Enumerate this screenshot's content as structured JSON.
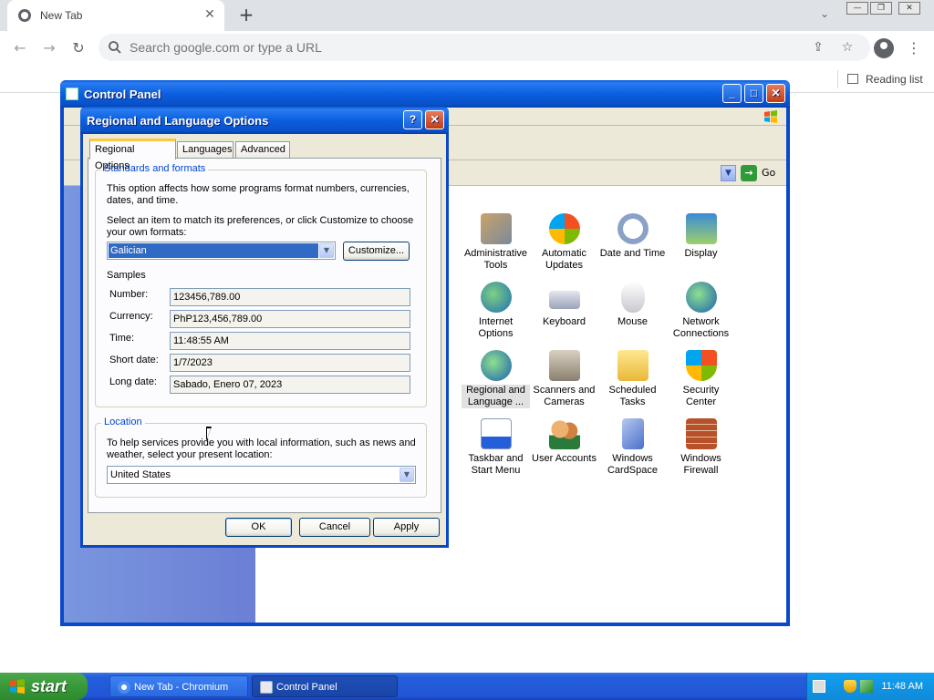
{
  "browser": {
    "tab_title": "New Tab",
    "omnibox_placeholder": "Search google.com or type a URL",
    "reading_list": "Reading list"
  },
  "control_panel": {
    "title": "Control Panel",
    "go_label": "Go",
    "items": [
      {
        "label": "Administrative Tools",
        "icon": "admin-tools-icon"
      },
      {
        "label": "Automatic Updates",
        "icon": "auto-updates-icon"
      },
      {
        "label": "Date and Time",
        "icon": "date-time-icon"
      },
      {
        "label": "Display",
        "icon": "display-icon"
      },
      {
        "label": "Internet Options",
        "icon": "internet-options-icon"
      },
      {
        "label": "Keyboard",
        "icon": "keyboard-icon"
      },
      {
        "label": "Mouse",
        "icon": "mouse-icon"
      },
      {
        "label": "Network Connections",
        "icon": "network-icon"
      },
      {
        "label": "Regional and Language ...",
        "icon": "regional-icon"
      },
      {
        "label": "Scanners and Cameras",
        "icon": "scanner-icon"
      },
      {
        "label": "Scheduled Tasks",
        "icon": "scheduled-tasks-icon"
      },
      {
        "label": "Security Center",
        "icon": "security-icon"
      },
      {
        "label": "Taskbar and Start Menu",
        "icon": "taskbar-icon"
      },
      {
        "label": "User Accounts",
        "icon": "user-accounts-icon"
      },
      {
        "label": "Windows CardSpace",
        "icon": "cardspace-icon"
      },
      {
        "label": "Windows Firewall",
        "icon": "firewall-icon"
      }
    ]
  },
  "dialog": {
    "title": "Regional and Language Options",
    "help_label": "?",
    "close_label": "✕",
    "tabs": [
      "Regional Options",
      "Languages",
      "Advanced"
    ],
    "standards": {
      "legend": "Standards and formats",
      "desc1": "This option affects how some programs format numbers, currencies, dates, and time.",
      "desc2": "Select an item to match its preferences, or click Customize to choose your own formats:",
      "selected_format": "Galician",
      "customize_label": "Customize...",
      "samples_label": "Samples",
      "samples": [
        {
          "label": "Number:",
          "value": "123456,789.00"
        },
        {
          "label": "Currency:",
          "value": "PhP123,456,789.00"
        },
        {
          "label": "Time:",
          "value": "11:48:55 AM"
        },
        {
          "label": "Short date:",
          "value": "1/7/2023"
        },
        {
          "label": "Long date:",
          "value": "Sabado, Enero 07, 2023"
        }
      ]
    },
    "location": {
      "legend": "Location",
      "desc": "To help services provide you with local information, such as news and weather, select your present location:",
      "value": "United States"
    },
    "ok_label": "OK",
    "cancel_label": "Cancel",
    "apply_label": "Apply"
  },
  "taskbar": {
    "start_label": "start",
    "tasks": [
      "New Tab - Chromium",
      "Control Panel"
    ],
    "clock": "11:48 AM"
  }
}
